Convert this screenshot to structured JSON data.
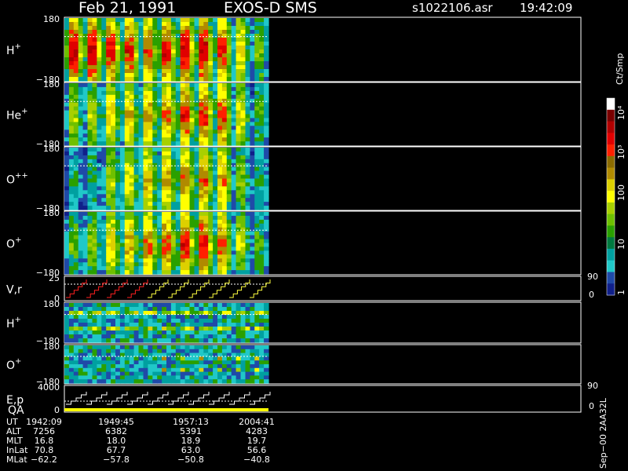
{
  "header": {
    "date": "Feb 21, 1991",
    "instrument": "EXOS-D SMS",
    "file": "s1022106.asr",
    "time": "19:42:09"
  },
  "panels": [
    {
      "id": "h-plus-spec",
      "label": "H",
      "sup": "+",
      "top_tick": "180",
      "bottom_tick": "−180",
      "kind": "spectrogram",
      "intensity": [
        1.0,
        1.0,
        0.95,
        0.92,
        0.85,
        0.95,
        1.0,
        1.0,
        0.9,
        0.65,
        0.45
      ]
    },
    {
      "id": "he-plus-spec",
      "label": "He",
      "sup": "+",
      "top_tick": "180",
      "bottom_tick": "−180",
      "kind": "spectrogram",
      "intensity": [
        0.55,
        0.55,
        0.7,
        0.72,
        0.78,
        0.82,
        0.9,
        0.92,
        0.9,
        0.6,
        0.4
      ]
    },
    {
      "id": "o-plusplus-spec",
      "label": "O",
      "sup": "++",
      "top_tick": "180",
      "bottom_tick": "−180",
      "kind": "spectrogram",
      "intensity": [
        0.3,
        0.35,
        0.55,
        0.62,
        0.72,
        0.76,
        0.8,
        0.85,
        0.78,
        0.5,
        0.35
      ]
    },
    {
      "id": "o-plus-spec",
      "label": "O",
      "sup": "+",
      "top_tick": "180",
      "bottom_tick": "−180",
      "kind": "spectrogram",
      "intensity": [
        0.45,
        0.5,
        0.7,
        0.74,
        0.82,
        0.86,
        0.92,
        0.95,
        0.85,
        0.55,
        0.4
      ]
    },
    {
      "id": "vr-panel",
      "label": "V,r",
      "sup": "",
      "top_tick": "25",
      "bottom_tick": "0",
      "right_top": "90",
      "right_bottom": "0",
      "kind": "steps"
    },
    {
      "id": "h-plus-2",
      "label": "H",
      "sup": "+",
      "top_tick": "180",
      "bottom_tick": "−180",
      "kind": "bands"
    },
    {
      "id": "o-plus-2",
      "label": "O",
      "sup": "+",
      "top_tick": "180",
      "bottom_tick": "−180",
      "kind": "bands2"
    },
    {
      "id": "ep-panel",
      "label": "E,p",
      "label2": "QA",
      "sup": "",
      "top_tick": "4000",
      "bottom_tick": "0",
      "right_top": "90",
      "right_bottom": "0",
      "kind": "ep"
    }
  ],
  "colorbar": {
    "unit": "Ct/Smp",
    "ticks": [
      "10⁴",
      "10³",
      "100",
      "10",
      "1"
    ],
    "colors": [
      "#ffffff",
      "#7a0000",
      "#b00000",
      "#e00000",
      "#ff2000",
      "#8b6b00",
      "#b08a00",
      "#ddd000",
      "#ffff00",
      "#a8d000",
      "#6ec000",
      "#2aa000",
      "#007a40",
      "#00a0a0",
      "#20c8c8",
      "#1f4aa8",
      "#10208a"
    ]
  },
  "footer": {
    "rows": [
      {
        "label": "UT",
        "values": [
          "1942:09",
          "1949:45",
          "1957:13",
          "2004:41"
        ]
      },
      {
        "label": "ALT",
        "values": [
          "7256",
          "6382",
          "5391",
          "4283"
        ]
      },
      {
        "label": "MLT",
        "values": [
          "16.8",
          "18.0",
          "18.9",
          "19.7"
        ]
      },
      {
        "label": "InLat",
        "values": [
          "70.8",
          "67.7",
          "63.0",
          "56.6"
        ]
      },
      {
        "label": "MLat",
        "values": [
          "−62.2",
          "−57.8",
          "−50.8",
          "−40.8"
        ]
      }
    ]
  },
  "side_text": "Sep−00  2AA32L",
  "colors": {
    "background": "#000000",
    "frame": "#ffffff",
    "red_trace": "#ff2020",
    "yellow_trace": "#ffff40",
    "qa_bar": "#ffff00"
  }
}
